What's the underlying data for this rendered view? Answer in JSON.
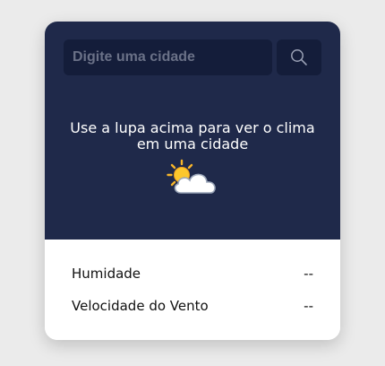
{
  "search": {
    "placeholder": "Digite uma cidade",
    "value": ""
  },
  "message": {
    "line1": "Use a lupa acima para ver o clima",
    "line2": "em uma cidade"
  },
  "icons": {
    "search": "search-icon",
    "weather": "sun-behind-cloud-icon"
  },
  "details": {
    "humidity_label": "Humidade",
    "humidity_value": "--",
    "wind_label": "Velocidade do Vento",
    "wind_value": "--"
  },
  "colors": {
    "panel": "#1f294a",
    "input": "#141d3a",
    "background": "#ebebeb"
  }
}
